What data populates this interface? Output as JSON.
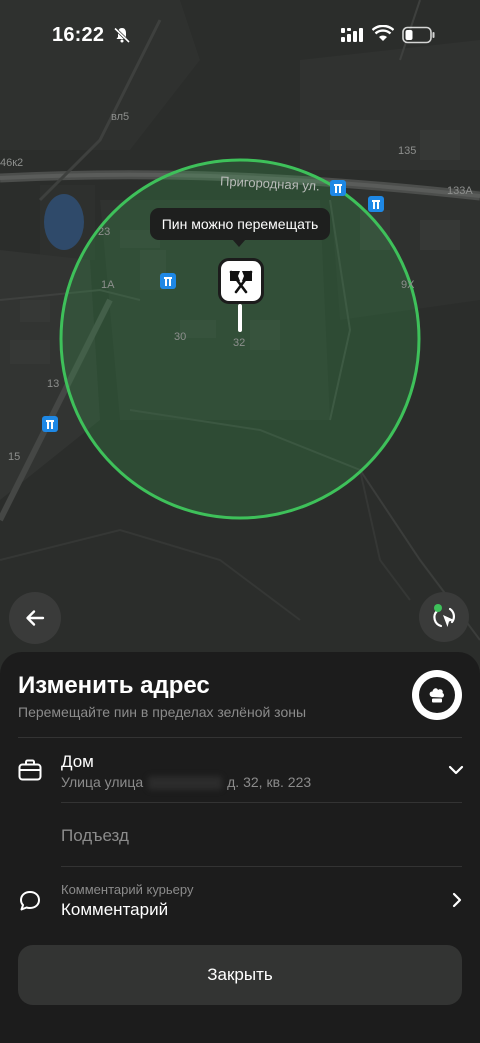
{
  "status_bar": {
    "time": "16:22"
  },
  "map": {
    "street_label": "Пригородная ул.",
    "numbers": [
      "вл5",
      "46к2",
      "135",
      "133А",
      "23",
      "1А",
      "30",
      "32",
      "13",
      "15",
      "9Х"
    ],
    "tooltip": "Пин можно перемещать",
    "zone_color": "#3ec15a"
  },
  "sheet": {
    "title": "Изменить адрес",
    "subtitle": "Перемещайте пин в пределах зелёной зоны",
    "address": {
      "name": "Дом",
      "street_prefix": "Улица улица",
      "street_suffix": "д. 32, кв. 223"
    },
    "entrance_placeholder": "Подъезд",
    "comment": {
      "label": "Комментарий курьеру",
      "value": "Комментарий"
    },
    "close_label": "Закрыть"
  }
}
